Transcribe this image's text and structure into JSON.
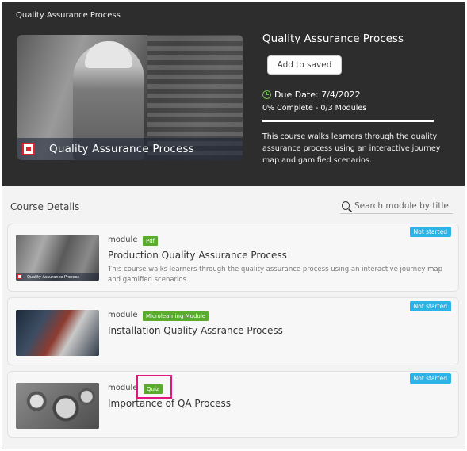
{
  "hero": {
    "small_title": "Quality Assurance Process",
    "image_caption": "Quality Assurance Process",
    "course_title": "Quality Assurance Process",
    "save_button": "Add to saved",
    "due_date": "Due Date: 7/4/2022",
    "progress_text": "0% Complete - 0/3 Modules",
    "progress_fraction": 0.0,
    "description": "This course walks learners through the quality assurance process using an interactive journey map and gamified scenarios."
  },
  "details": {
    "heading": "Course Details",
    "search_placeholder": "Search module by title"
  },
  "modules": [
    {
      "type_label": "module",
      "badge": "Pdf",
      "title": "Production Quality Assurance Process",
      "description": "This course walks learners through the quality assurance process using an interactive journey map and gamified scenarios.",
      "status": "Not started",
      "thumb_caption": "Quality Assurance Process"
    },
    {
      "type_label": "module",
      "badge": "Microlearning Module",
      "title": "Installation Quality Assrance Process",
      "status": "Not started"
    },
    {
      "type_label": "module",
      "badge": "Quiz",
      "title": "Importance of QA Process",
      "status": "Not started"
    }
  ],
  "colors": {
    "header_bg": "#2d2d2d",
    "badge_green": "#5aab2e",
    "status_blue": "#2eb3e7",
    "highlight_pink": "#e0157e",
    "clock_green": "#6cc04a"
  },
  "icons": [
    "clock-icon",
    "search-icon",
    "logo-icon"
  ]
}
